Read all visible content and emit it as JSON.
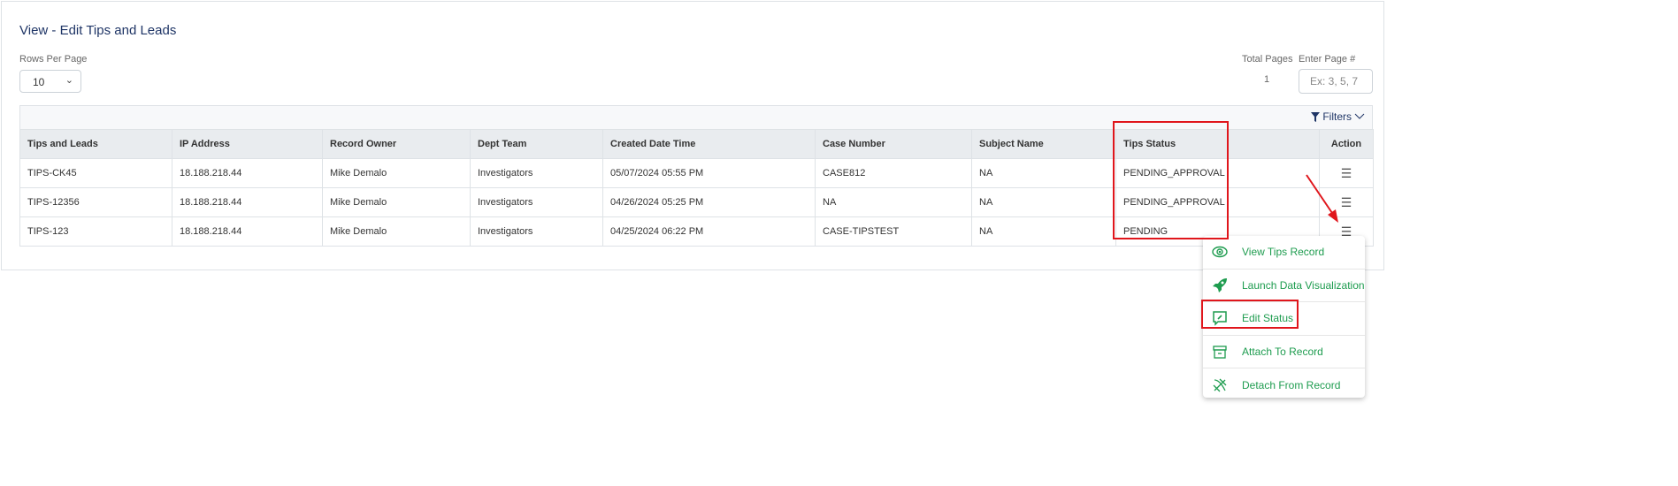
{
  "page": {
    "title": "View - Edit Tips and Leads"
  },
  "rows_per_page": {
    "label": "Rows Per Page",
    "value": "10"
  },
  "pagination": {
    "total_label": "Total Pages",
    "total_value": "1",
    "enter_label": "Enter Page #",
    "enter_placeholder": "Ex: 3, 5, 7"
  },
  "filters": {
    "label": "Filters"
  },
  "table": {
    "columns": [
      "Tips and Leads",
      "IP Address",
      "Record Owner",
      "Dept Team",
      "Created Date Time",
      "Case Number",
      "Subject Name",
      "Tips Status",
      "Action"
    ],
    "rows": [
      [
        "TIPS-CK45",
        "18.188.218.44",
        "Mike Demalo",
        "Investigators",
        "05/07/2024 05:55 PM",
        "CASE812",
        "NA",
        "PENDING_APPROVAL"
      ],
      [
        "TIPS-12356",
        "18.188.218.44",
        "Mike Demalo",
        "Investigators",
        "04/26/2024 05:25 PM",
        "NA",
        "NA",
        "PENDING_APPROVAL"
      ],
      [
        "TIPS-123",
        "18.188.218.44",
        "Mike Demalo",
        "Investigators",
        "04/25/2024 06:22 PM",
        "CASE-TIPSTEST",
        "NA",
        "PENDING"
      ]
    ]
  },
  "action_menu": {
    "items": [
      {
        "label": "View Tips Record",
        "icon": "eye-icon"
      },
      {
        "label": "Launch Data Visualization",
        "icon": "rocket-icon"
      },
      {
        "label": "Edit Status",
        "icon": "edit-message-icon"
      },
      {
        "label": "Attach To Record",
        "icon": "archive-box-icon"
      },
      {
        "label": "Detach From Record",
        "icon": "unlink-icon"
      }
    ]
  },
  "colors": {
    "accent_green": "#1e9c4f",
    "title_navy": "#1f3566",
    "annotation_red": "#e0161c"
  }
}
